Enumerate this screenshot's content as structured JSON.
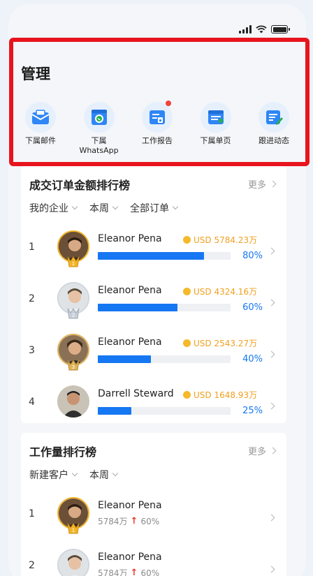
{
  "management": {
    "title": "管理",
    "items": [
      {
        "label": "下属邮件",
        "icon": "mail-icon"
      },
      {
        "label": "下属\nWhatsApp",
        "icon": "whatsapp-icon"
      },
      {
        "label": "工作报告",
        "icon": "report-icon",
        "badge": true
      },
      {
        "label": "下属单页",
        "icon": "browser-page-icon"
      },
      {
        "label": "跟进动态",
        "icon": "followup-edit-icon"
      }
    ]
  },
  "sales_ranking": {
    "title": "成交订单金额排行榜",
    "more": "更多",
    "filters": [
      "我的企业",
      "本周",
      "全部订单"
    ],
    "rows": [
      {
        "rank": "1",
        "name": "Eleanor Pena",
        "amount": "USD 5784.23万",
        "percent": "80%",
        "progress": 0.8,
        "medal": "1"
      },
      {
        "rank": "2",
        "name": "Eleanor Pena",
        "amount": "USD 4324.16万",
        "percent": "60%",
        "progress": 0.6,
        "medal": "2"
      },
      {
        "rank": "3",
        "name": "Eleanor Pena",
        "amount": "USD 2543.27万",
        "percent": "40%",
        "progress": 0.4,
        "medal": "3"
      },
      {
        "rank": "4",
        "name": "Darrell Steward",
        "amount": "USD 1648.93万",
        "percent": "25%",
        "progress": 0.25,
        "medal": ""
      }
    ]
  },
  "workload_ranking": {
    "title": "工作量排行榜",
    "more": "更多",
    "filters": [
      "新建客户",
      "本周"
    ],
    "rows": [
      {
        "rank": "1",
        "name": "Eleanor Pena",
        "value": "5784万",
        "change": "60%",
        "medal": "1"
      },
      {
        "rank": "2",
        "name": "Eleanor Pena",
        "value": "5784万",
        "change": "60%",
        "medal": "2"
      }
    ]
  },
  "colors": {
    "accent": "#1677f2",
    "gold": "#f0a020",
    "highlight": "#e8141d",
    "up": "#e83a32"
  }
}
